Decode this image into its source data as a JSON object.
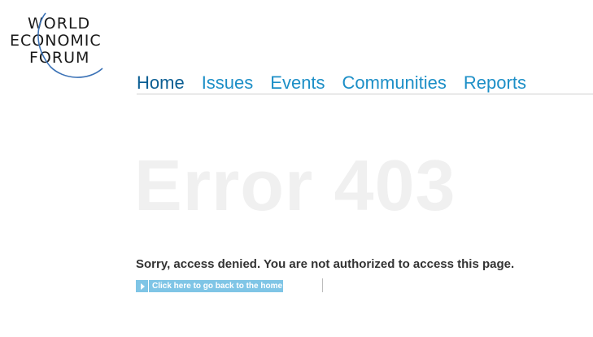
{
  "logo": {
    "line1": "WORLD",
    "line2": "ECONOMIC",
    "line3": "FORUM"
  },
  "nav": {
    "items": [
      {
        "label": "Home"
      },
      {
        "label": "Issues"
      },
      {
        "label": "Events"
      },
      {
        "label": "Communities"
      },
      {
        "label": "Reports"
      }
    ]
  },
  "error": {
    "title": "Error 403",
    "message": "Sorry, access denied. You are not authorized to access this page."
  },
  "back_link": {
    "label": "Click here to go back to the home"
  },
  "colors": {
    "nav_link": "#1d8fc7",
    "nav_active": "#0b5e93",
    "button_bg": "#7fc5e6",
    "error_title": "#f0f0f0"
  }
}
